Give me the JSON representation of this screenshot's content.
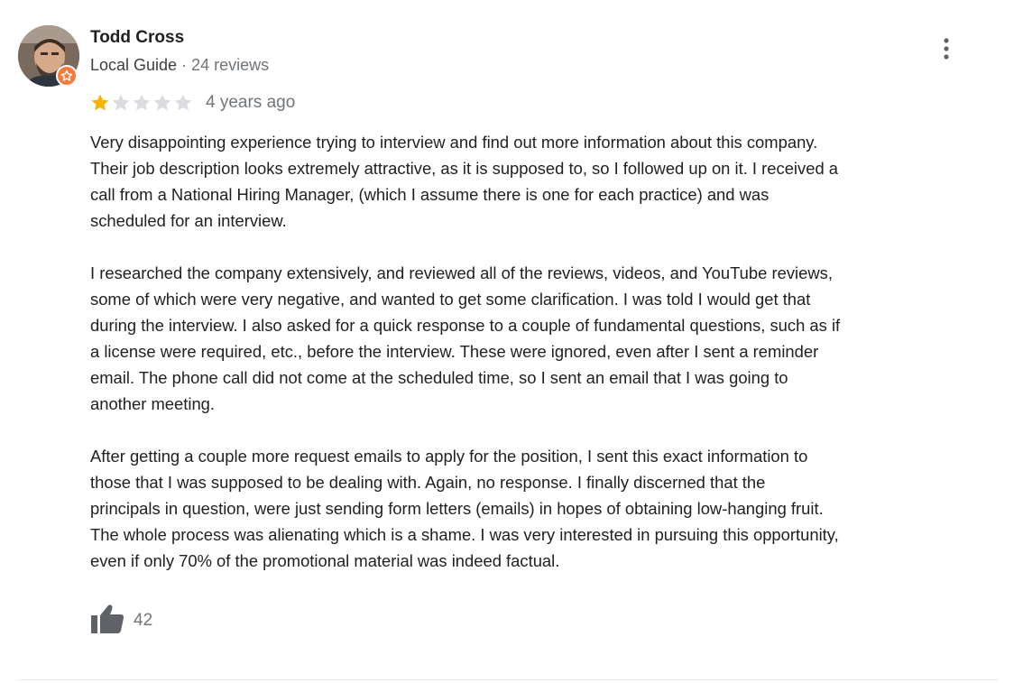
{
  "reviewer": {
    "name": "Todd Cross",
    "badge": "Local Guide",
    "separator": " · ",
    "review_count": "24 reviews",
    "avatar_icon": "user-avatar-photo",
    "badge_icon": "local-guide-star-badge"
  },
  "review": {
    "rating": 1,
    "rating_max": 5,
    "time_ago": "4 years ago",
    "paragraphs": [
      "Very disappointing experience trying to interview and find out more information about this company.\nTheir job description looks extremely attractive, as it is supposed to, so I followed up on it. I received a\ncall from a National Hiring Manager, (which I assume there is one for each practice) and was\nscheduled for an interview.",
      "I researched the company extensively, and reviewed all of the reviews, videos, and YouTube reviews,\nsome of which were very negative, and wanted to get some clarification. I was told I would get that\nduring the interview. I also asked for a quick response to a couple of fundamental questions, such as if\na license were required, etc., before the interview. These were ignored, even after I sent a reminder\nemail. The phone call did not come at the scheduled time, so I sent an email that I was going to\nanother meeting.",
      "After getting a couple more request emails to apply for the position, I sent this exact information to\nthose that I was supposed to be dealing with. Again, no response. I finally discerned that the\nprincipals in question, were just sending form letters (emails) in hopes of obtaining low-hanging fruit.\nThe whole process was alienating which is a shame. I was very interested in pursuing this opportunity,\neven if only 70% of the promotional material was indeed factual."
    ],
    "likes": "42"
  },
  "colors": {
    "star_filled": "#f6b400",
    "star_empty": "#dadce0",
    "secondary_text": "#70757a",
    "primary_text": "#202124",
    "icon_dark": "#5f6368",
    "badge_orange": "#f47b3f"
  },
  "icons": {
    "more_menu": "more-vert-icon",
    "like": "thumb-up-icon",
    "star": "star-icon"
  }
}
